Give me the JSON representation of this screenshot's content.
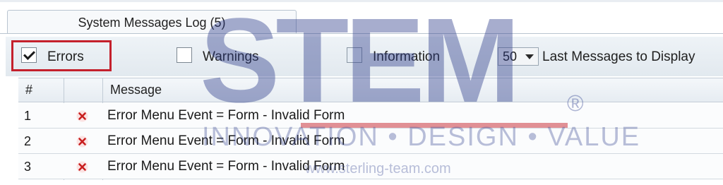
{
  "tab": {
    "label": "System Messages Log (5)"
  },
  "filters": {
    "errors": {
      "label": "Errors",
      "checked": true
    },
    "warnings": {
      "label": "Warnings",
      "checked": false
    },
    "information": {
      "label": "Information",
      "checked": false
    },
    "display_count": {
      "value": "50",
      "label": "Last Messages to Display"
    }
  },
  "table": {
    "columns": [
      "#",
      "",
      "Message"
    ],
    "rows": [
      {
        "num": "1",
        "icon": "error-x-icon",
        "message": "Error Menu Event = Form - Invalid Form"
      },
      {
        "num": "2",
        "icon": "error-x-icon",
        "message": "Error Menu Event = Form - Invalid Form"
      },
      {
        "num": "3",
        "icon": "error-x-icon",
        "message": "Error Menu Event = Form - Invalid Form"
      }
    ]
  },
  "watermark": {
    "brand": "STEM",
    "registered": "®",
    "tagline": "INNOVATION • DESIGN • VALUE",
    "url": "www.sterling-team.com"
  },
  "colors": {
    "highlight": "#c4202c",
    "error_icon": "#c81e1e",
    "watermark": "#2f3e8c"
  }
}
